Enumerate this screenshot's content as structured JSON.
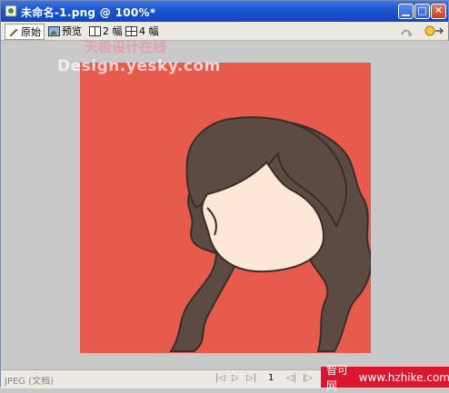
{
  "window": {
    "title": "未命名-1.png @ 100%*",
    "buttons": [
      "minimize",
      "maximize",
      "close"
    ]
  },
  "toolbar": {
    "tabs": [
      {
        "label": "原始",
        "icon": "pencil-icon",
        "active": true
      },
      {
        "label": "预览",
        "icon": "preview-icon",
        "active": false
      },
      {
        "label": "2 幅",
        "icon": "two-up-icon",
        "active": false
      },
      {
        "label": "4 幅",
        "icon": "four-up-icon",
        "active": false
      }
    ]
  },
  "watermark": {
    "cn": "天极设计在线",
    "en": "Design.yesky.com"
  },
  "colors": {
    "canvas_background": "#e75b4c",
    "hair": "#5b4b42",
    "face": "#fde8d5",
    "workspace": "#c9c9c9"
  },
  "statusbar": {
    "format": "JPEG (文档)",
    "page": "1"
  },
  "banner": {
    "site_cn": "智可网",
    "url": "www.hzhike.com"
  }
}
